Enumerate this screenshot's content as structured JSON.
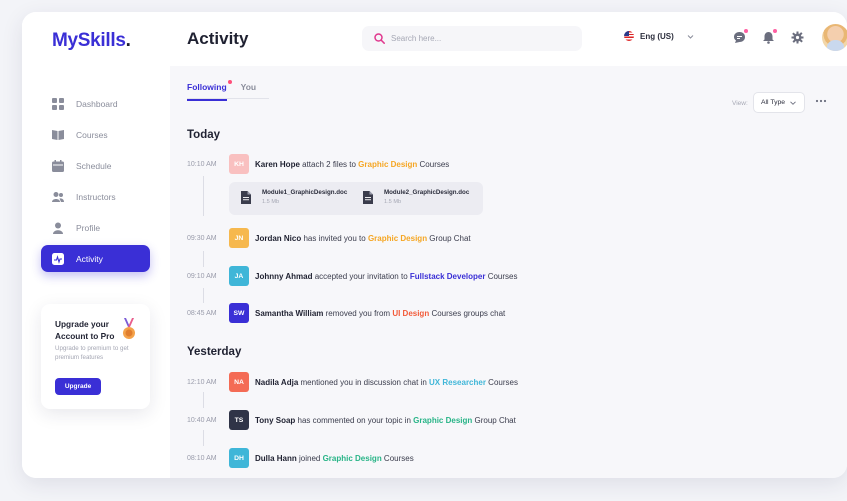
{
  "app": {
    "logo_brand": "MySkills",
    "logo_tail": "."
  },
  "sidebar": {
    "items": [
      {
        "label": "Dashboard",
        "icon": "dashboard-icon",
        "active": false
      },
      {
        "label": "Courses",
        "icon": "book-icon",
        "active": false
      },
      {
        "label": "Schedule",
        "icon": "calendar-icon",
        "active": false
      },
      {
        "label": "Instructors",
        "icon": "users-icon",
        "active": false
      },
      {
        "label": "Profile",
        "icon": "user-icon",
        "active": false
      },
      {
        "label": "Activity",
        "icon": "activity-icon",
        "active": true
      }
    ],
    "upgrade": {
      "title": "Upgrade your Account to Pro",
      "subtitle": "Upgrade to premium to get premium features",
      "button": "Upgrade"
    }
  },
  "header": {
    "title": "Activity",
    "search_placeholder": "Search here...",
    "language": "Eng (US)"
  },
  "main": {
    "tabs": [
      {
        "label": "Following",
        "active": true
      },
      {
        "label": "You",
        "active": false
      }
    ],
    "view_label": "View:",
    "view_value": "All Type",
    "sections": [
      {
        "title": "Today"
      },
      {
        "title": "Yesterday"
      }
    ],
    "activities": [
      {
        "time": "10:10 AM",
        "initials": "KH",
        "color": "#f9c0c0",
        "name": "Karen Hope",
        "before": " attach 2 files to ",
        "highlight": "Graphic Design",
        "hl_color": "#f5a623",
        "after": " Courses"
      },
      {
        "time": "09:30 AM",
        "initials": "JN",
        "color": "#f6b84e",
        "name": "Jordan Nico",
        "before": " has invited you to ",
        "highlight": "Graphic Design",
        "hl_color": "#f5a623",
        "after": " Group Chat"
      },
      {
        "time": "09:10 AM",
        "initials": "JA",
        "color": "#3fb6d8",
        "name": "Johnny Ahmad",
        "before": " accepted your invitation to ",
        "highlight": "Fullstack Developer",
        "hl_color": "#3a2fd6",
        "after": " Courses"
      },
      {
        "time": "08:45 AM",
        "initials": "SW",
        "color": "#3a2fd6",
        "name": "Samantha William",
        "before": " removed you from ",
        "highlight": "UI Design",
        "hl_color": "#f25b3a",
        "after": " Courses groups chat"
      },
      {
        "time": "12:10 AM",
        "initials": "NA",
        "color": "#f46b55",
        "name": "Nadila Adja",
        "before": " mentioned you in discussion chat in ",
        "highlight": "UX Researcher",
        "hl_color": "#3fb6d8",
        "after": " Courses"
      },
      {
        "time": "10:40 AM",
        "initials": "TS",
        "color": "#2f3447",
        "name": "Tony Soap",
        "before": " has commented on your topic in ",
        "highlight": "Graphic Design",
        "hl_color": "#28b487",
        "after": " Group Chat"
      },
      {
        "time": "08:10 AM",
        "initials": "DH",
        "color": "#3fb6d8",
        "name": "Dulla Hann",
        "before": " joined ",
        "highlight": "Graphic Design",
        "hl_color": "#28b487",
        "after": " Courses"
      }
    ],
    "files": [
      {
        "name": "Module1_GraphicDesign.doc",
        "size": "1.5 Mb"
      },
      {
        "name": "Module2_GraphicDesign.doc",
        "size": "1.5 Mb"
      }
    ]
  }
}
